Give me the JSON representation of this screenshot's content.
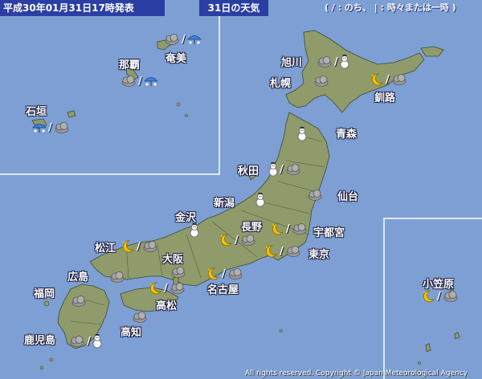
{
  "header": {
    "date_text": "平成30年01月31日17時発表",
    "title": "31日の天気",
    "legend": "( / : のち、 | : 時々または一時 )"
  },
  "cities": [
    {
      "id": "amami",
      "name": "奄美",
      "forecast": {
        "first": "cloudy",
        "second": "snow-rain"
      }
    },
    {
      "id": "naha",
      "name": "那覇",
      "forecast": {
        "first": "cloudy",
        "second": "snow-rain"
      }
    },
    {
      "id": "ishigaki",
      "name": "石垣",
      "forecast": {
        "first": "snow-rain",
        "second": "cloudy"
      }
    },
    {
      "id": "asahikawa",
      "name": "旭川",
      "forecast": {
        "first": "cloudy",
        "second": "snow"
      }
    },
    {
      "id": "sapporo",
      "name": "札幌",
      "forecast": {
        "first": "cloudy"
      }
    },
    {
      "id": "kushiro",
      "name": "釧路",
      "forecast": {
        "first": "clear-night",
        "second": "cloudy"
      }
    },
    {
      "id": "aomori",
      "name": "青森",
      "forecast": {
        "first": "snow"
      }
    },
    {
      "id": "akita",
      "name": "秋田",
      "forecast": {
        "first": "snow",
        "second": "cloudy"
      }
    },
    {
      "id": "sendai",
      "name": "仙台",
      "forecast": {
        "first": "cloudy"
      }
    },
    {
      "id": "niigata",
      "name": "新潟",
      "forecast": {
        "first": "snow"
      }
    },
    {
      "id": "kanazawa",
      "name": "金沢",
      "forecast": {
        "first": "snow"
      }
    },
    {
      "id": "nagano",
      "name": "長野",
      "forecast": {
        "first": "clear-night",
        "second": "cloudy"
      }
    },
    {
      "id": "utsunomiya",
      "name": "宇都宮",
      "forecast": {
        "first": "clear-night",
        "second": "cloudy"
      }
    },
    {
      "id": "tokyo",
      "name": "東京",
      "forecast": {
        "first": "clear-night",
        "second": "cloudy"
      }
    },
    {
      "id": "matsue",
      "name": "松江",
      "forecast": {
        "first": "clear-night",
        "second": "cloudy"
      }
    },
    {
      "id": "osaka",
      "name": "大阪",
      "forecast": {
        "first": "cloudy"
      }
    },
    {
      "id": "nagoya",
      "name": "名古屋",
      "forecast": {
        "first": "clear-night",
        "second": "cloudy"
      }
    },
    {
      "id": "hiroshima",
      "name": "広島",
      "forecast": {
        "first": "cloudy"
      }
    },
    {
      "id": "takamatsu",
      "name": "高松",
      "forecast": {
        "first": "clear-night",
        "second": "cloudy"
      }
    },
    {
      "id": "fukuoka",
      "name": "福岡",
      "forecast": {
        "first": "cloudy"
      }
    },
    {
      "id": "kochi",
      "name": "高知",
      "forecast": {
        "first": "cloudy"
      }
    },
    {
      "id": "kagoshima",
      "name": "鹿児島",
      "forecast": {
        "first": "cloudy",
        "second": "snow"
      }
    },
    {
      "id": "ogasawara",
      "name": "小笠原",
      "forecast": {
        "first": "clear-night",
        "second": "cloudy"
      }
    }
  ],
  "copyright": "All rights reserved. Copyright © Japan Meteorological Agency",
  "colors": {
    "sea": "#7d9fd3",
    "land": "#8f9b6b",
    "header": "#2b3ea4",
    "inset_border": "#ffffff"
  },
  "icons": {
    "cloudy": "cloud-icon",
    "snow": "snowman-icon",
    "snow-rain": "umbrella-snow-icon",
    "clear-night": "moon-icon"
  }
}
